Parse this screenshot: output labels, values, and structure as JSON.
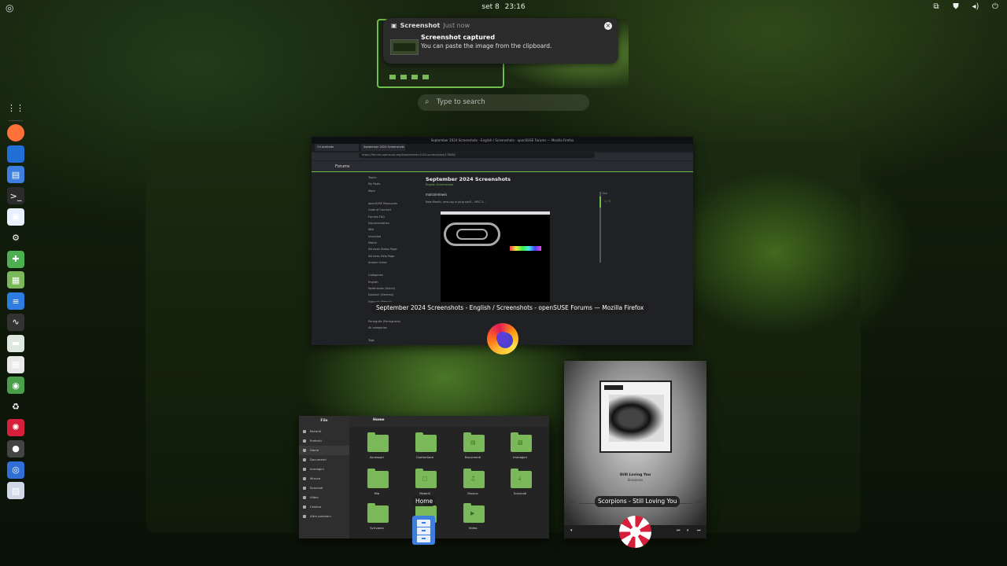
{
  "topbar": {
    "activities_icon": "activities-icon",
    "date": "set 8",
    "time": "23:16",
    "tray_icons": [
      "screencast-icon",
      "shield-icon",
      "volume-icon",
      "power-icon"
    ]
  },
  "notification": {
    "app": "Screenshot",
    "when": "Just now",
    "title": "Screenshot captured",
    "body": "You can paste the image from the clipboard."
  },
  "search": {
    "placeholder": "Type to search"
  },
  "dash": {
    "apps": [
      {
        "name": "app-grid-icon",
        "color": "#00000000",
        "glyph": "⋮⋮"
      },
      {
        "name": "firefox-icon",
        "color": "#ff7139",
        "glyph": ""
      },
      {
        "name": "thunderbird-icon",
        "color": "#1f6fd6",
        "glyph": ""
      },
      {
        "name": "files-icon",
        "color": "#3d7ede",
        "glyph": "▤"
      },
      {
        "name": "terminal-icon",
        "color": "#2b2b2b",
        "glyph": ">_"
      },
      {
        "name": "software-icon",
        "color": "#e8f0ff",
        "glyph": "▣"
      },
      {
        "name": "settings-icon",
        "color": "#00000000",
        "glyph": "⚙"
      },
      {
        "name": "extensions-icon",
        "color": "#4caf50",
        "glyph": "✚"
      },
      {
        "name": "archive-icon",
        "color": "#7bb85a",
        "glyph": "▦"
      },
      {
        "name": "text-editor-icon",
        "color": "#2f7ce0",
        "glyph": "≡"
      },
      {
        "name": "system-monitor-icon",
        "color": "#333333",
        "glyph": "∿"
      },
      {
        "name": "image-viewer-icon",
        "color": "#dde8e0",
        "glyph": "▬"
      },
      {
        "name": "calculator-icon",
        "color": "#e8e8e8",
        "glyph": "▦"
      },
      {
        "name": "opensuse-icon",
        "color": "#4a9e4a",
        "glyph": "◉"
      },
      {
        "name": "recycle-icon",
        "color": "#00000000",
        "glyph": "♻"
      },
      {
        "name": "lollypop-icon",
        "color": "#d6203b",
        "glyph": "✺"
      },
      {
        "name": "dark-app-icon",
        "color": "#444444",
        "glyph": "●"
      },
      {
        "name": "chromium-icon",
        "color": "#2f6fd6",
        "glyph": "◎"
      },
      {
        "name": "screenshot-app-icon",
        "color": "#d0d8e8",
        "glyph": "▧"
      }
    ]
  },
  "firefox_window": {
    "title": "September 2024 Screenshots - English / Screenshots - openSUSE Forums — Mozilla Firefox",
    "titlebar_text": "September 2024 Screenshots - English / Screenshots - openSUSE Forums — Mozilla Firefox",
    "tab1": "Oil Aceitada",
    "tab2": "September 2024 Screenshots",
    "url": "https://forums.opensuse.org/t/september-2024-screenshots/178682",
    "site_name": "Forums",
    "sidebar": [
      "Topics",
      "My Posts",
      "More",
      "",
      "openSUSE Resources",
      "Code of Conduct",
      "Forums FAQ",
      "Documentation",
      "Wiki",
      "Unsolved",
      "Matrix",
      "Services Status Page",
      "Services Help Page",
      "Answer Index",
      "",
      "Categories",
      "English",
      "Nederlands (Dutch)",
      "Deutsch (German)",
      "Français (French)",
      "",
      "",
      "Português (Portuguese)",
      "All categories",
      "",
      "Tags"
    ],
    "post_title": "September 2024 Screenshots",
    "post_crumb": "English  Screenshots",
    "author": "malcolmlewis",
    "post_line": "New Month, new log-in plug stuff...   MSC 3...",
    "timeline_top": "8 Sep",
    "timeline_pos": "1 / 3",
    "timeline_sub": "8 Sep"
  },
  "window_title_label": "September 2024 Screenshots - English / Screenshots - openSUSE Forums — Mozilla Firefox",
  "files_window": {
    "sidebar_title": "File",
    "header_title": "Home",
    "sidebar": [
      "Recenti",
      "Preferiti",
      "Home",
      "Documenti",
      "Immagini",
      "Musica",
      "Scaricati",
      "Video",
      "Cestino",
      "Altre posizioni"
    ],
    "folders": [
      {
        "label": "Accessori",
        "glyph": ""
      },
      {
        "label": "Contenitore",
        "glyph": ""
      },
      {
        "label": "Documenti",
        "glyph": "▤"
      },
      {
        "label": "Immagini",
        "glyph": "▨"
      },
      {
        "label": "Mia",
        "glyph": ""
      },
      {
        "label": "Modelli",
        "glyph": "▢"
      },
      {
        "label": "Musica",
        "glyph": "♫"
      },
      {
        "label": "Scaricati",
        "glyph": "↓"
      },
      {
        "label": "Scrivania",
        "glyph": ""
      },
      {
        "label": "",
        "glyph": ""
      },
      {
        "label": "Video",
        "glyph": "▶"
      }
    ]
  },
  "files_tooltip": "Home",
  "music_window": {
    "band": "SCORPIONS",
    "song": "Still Loving You",
    "artist": "Scorpions",
    "time_elapsed": "0:01",
    "time_total": "6:27"
  },
  "music_tooltip": "Scorpions - Still Loving You"
}
